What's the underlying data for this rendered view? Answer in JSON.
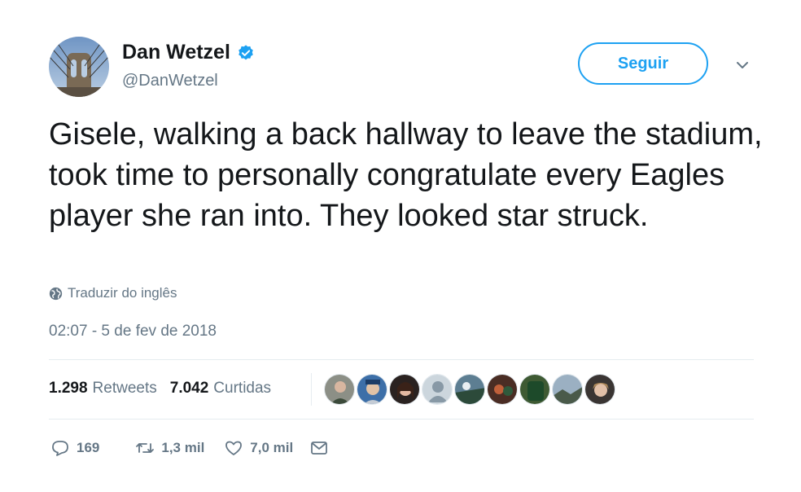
{
  "author": {
    "name": "Dan Wetzel",
    "handle": "@DanWetzel"
  },
  "follow_button": {
    "label": "Seguir"
  },
  "tweet": {
    "text": "Gisele, walking a back hallway to leave the stadium, took time to personally congratulate every Eagles player she ran into. They looked star struck.",
    "translate_label": "Traduzir do inglês",
    "timestamp": "02:07 - 5 de fev de 2018"
  },
  "stats": {
    "retweets_count": "1.298",
    "retweets_label": "Retweets",
    "likes_count": "7.042",
    "likes_label": "Curtidas"
  },
  "actions": {
    "reply_count": "169",
    "retweet_count": "1,3 mil",
    "like_count": "7,0 mil"
  },
  "colors": {
    "accent": "#1da1f2",
    "muted": "#657786",
    "text": "#14171a"
  },
  "icons": [
    "verified-icon",
    "chevron-down-icon",
    "globe-icon",
    "reply-icon",
    "retweet-icon",
    "like-icon",
    "message-icon"
  ]
}
